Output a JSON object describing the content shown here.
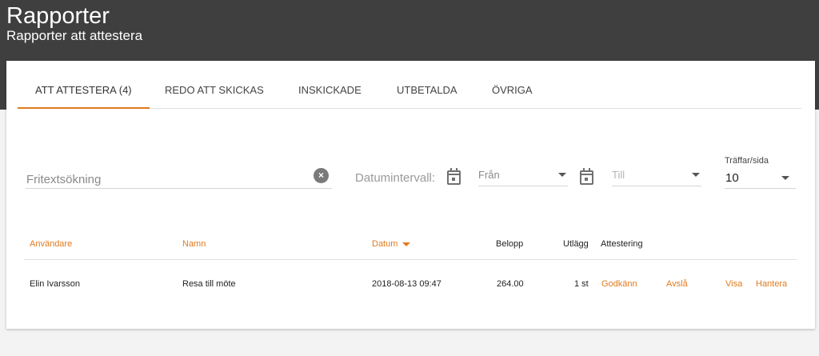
{
  "header": {
    "title": "Rapporter",
    "subtitle": "Rapporter att attestera"
  },
  "tabs": [
    {
      "label": "ATT ATTESTERA (4)",
      "active": true
    },
    {
      "label": "REDO ATT SKICKAS",
      "active": false
    },
    {
      "label": "INSKICKADE",
      "active": false
    },
    {
      "label": "UTBETALDA",
      "active": false
    },
    {
      "label": "ÖVRIGA",
      "active": false
    }
  ],
  "filters": {
    "search_placeholder": "Fritextsökning",
    "clear_icon": "close-circle-icon",
    "date_label": "Datumintervall:",
    "from_placeholder": "Från",
    "to_placeholder": "Till",
    "hits_label": "Träffar/sida",
    "hits_value": "10"
  },
  "table": {
    "headers": {
      "user": "Användare",
      "name": "Namn",
      "date": "Datum",
      "amount": "Belopp",
      "outlay": "Utlägg",
      "attest": "Attestering"
    },
    "rows": [
      {
        "user": "Elin Ivarsson",
        "name": "Resa till möte",
        "date": "2018-08-13 09:47",
        "amount": "264.00",
        "outlay": "1 st",
        "approve": "Godkänn",
        "reject": "Avslå",
        "view": "Visa",
        "manage": "Hantera"
      }
    ]
  },
  "colors": {
    "accent": "#e07a1e",
    "header_bg": "#3f3f3f"
  }
}
